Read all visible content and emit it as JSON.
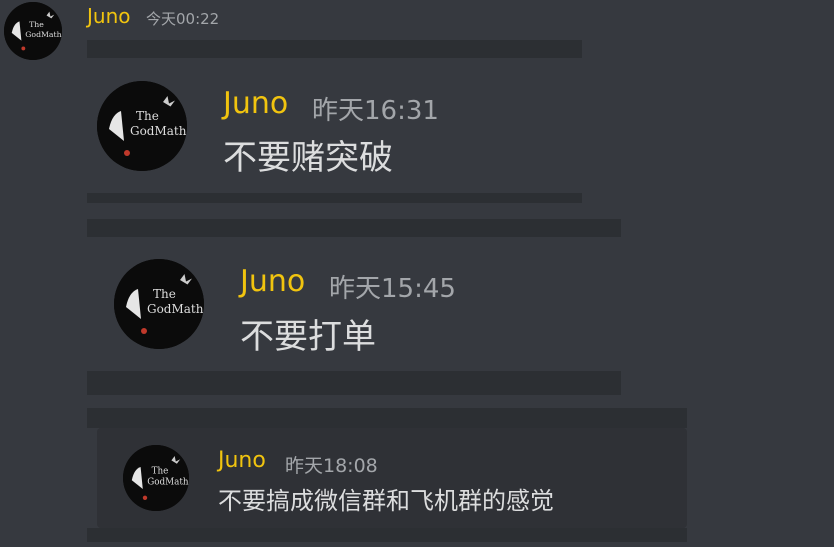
{
  "header": {
    "username": "Juno",
    "timestamp": "今天00:22",
    "avatar_icon": "godfather-avatar-icon"
  },
  "embeds": [
    {
      "username": "Juno",
      "timestamp": "昨天16:31",
      "message": "不要赌突破",
      "avatar_icon": "godfather-avatar-icon"
    },
    {
      "username": "Juno",
      "timestamp": "昨天15:45",
      "message": "不要打单",
      "avatar_icon": "godfather-avatar-icon"
    },
    {
      "username": "Juno",
      "timestamp": "昨天18:08",
      "message": "不要搞成微信群和飞机群的感觉",
      "avatar_icon": "godfather-avatar-icon"
    }
  ],
  "colors": {
    "background": "#36393f",
    "username": "#f1c40f",
    "timestamp": "#a3a6aa",
    "message_text": "#dcddde",
    "bars": "#2c2f33",
    "card": "#2f3136"
  }
}
